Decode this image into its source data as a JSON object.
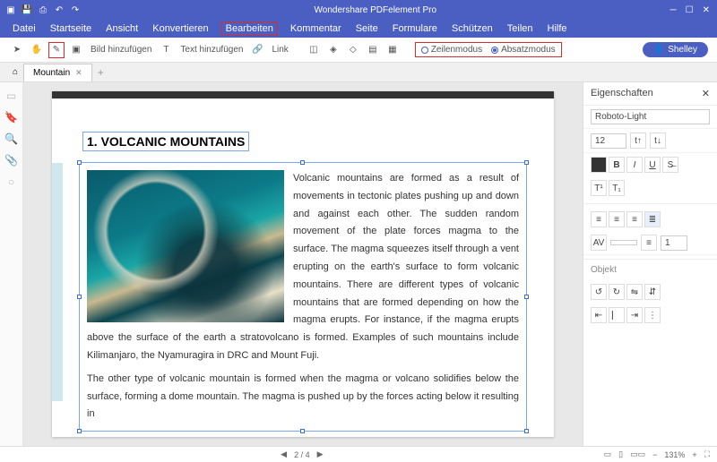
{
  "titlebar": {
    "app_title": "Wondershare PDFelement Pro"
  },
  "menu": {
    "items": [
      "Datei",
      "Startseite",
      "Ansicht",
      "Konvertieren",
      "Bearbeiten",
      "Kommentar",
      "Seite",
      "Formulare",
      "Schützen",
      "Teilen",
      "Hilfe"
    ],
    "active": 4
  },
  "toolbar": {
    "add_image": "Bild hinzufügen",
    "add_text": "Text hinzufügen",
    "link": "Link",
    "mode_line": "Zeilenmodus",
    "mode_para": "Absatzmodus",
    "user": "Shelley"
  },
  "tabs": {
    "name": "Mountain"
  },
  "doc": {
    "heading": "1. VOLCANIC MOUNTAINS",
    "para1": "Volcanic mountains are formed as a result of movements in tectonic plates pushing up and down and against each other. The sudden random movement of the plate forces magma to the surface. The magma squeezes itself through a vent erupting on the earth's surface to form volcanic mountains. There are different types of volcanic mountains that are formed depending on how the magma erupts. For instance, if the magma erupts above the surface of the earth a stratovolcano is formed. Examples of such mountains include Kilimanjaro, the Nyamuragira in DRC and Mount Fuji.",
    "para2": "The other type of volcanic mountain is formed when the magma or volcano solidifies below the surface, forming a dome mountain. The magma is pushed up by the forces acting below it resulting in"
  },
  "rightpanel": {
    "title": "Eigenschaften",
    "font": "Roboto-Light",
    "size": "12",
    "object": "Objekt"
  },
  "status": {
    "page": "2 / 4",
    "zoom": "131%"
  }
}
